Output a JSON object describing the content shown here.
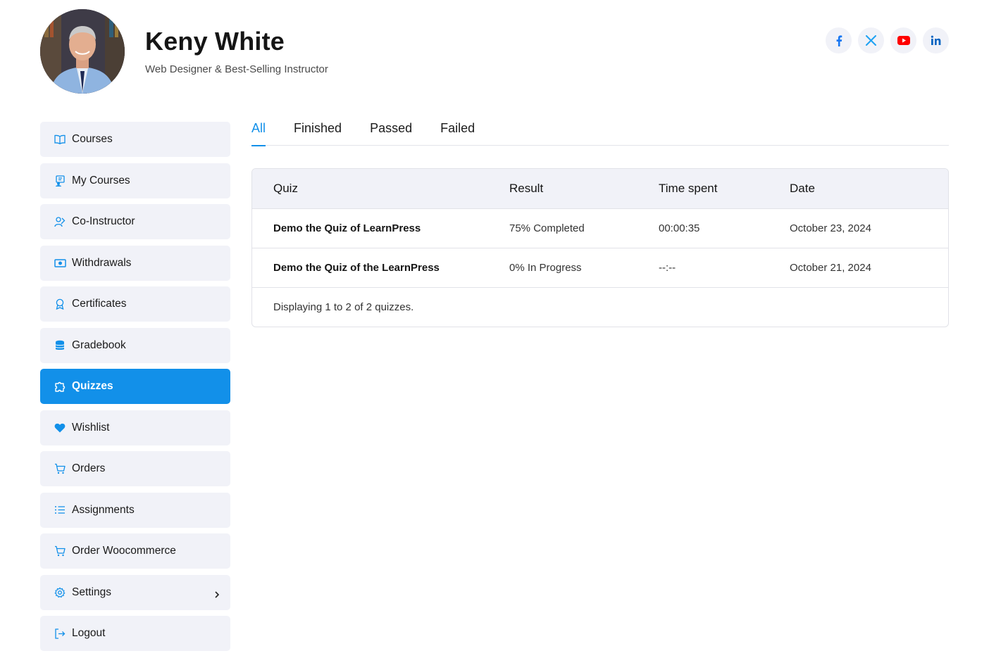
{
  "profile": {
    "name": "Keny White",
    "role": "Web Designer & Best-Selling Instructor"
  },
  "socials": [
    {
      "icon": "facebook-icon",
      "color": "#1877f2"
    },
    {
      "icon": "x-twitter-icon",
      "color": "#1da1f2"
    },
    {
      "icon": "youtube-icon",
      "color": "#ff0000"
    },
    {
      "icon": "linkedin-icon",
      "color": "#0a66c2"
    }
  ],
  "sidebar": {
    "items": [
      {
        "label": "Courses",
        "icon": "book-open-icon"
      },
      {
        "label": "My Courses",
        "icon": "my-courses-icon"
      },
      {
        "label": "Co-Instructor",
        "icon": "users-icon"
      },
      {
        "label": "Withdrawals",
        "icon": "money-icon"
      },
      {
        "label": "Certificates",
        "icon": "award-icon"
      },
      {
        "label": "Gradebook",
        "icon": "database-icon"
      },
      {
        "label": "Quizzes",
        "icon": "puzzle-icon",
        "active": true
      },
      {
        "label": "Wishlist",
        "icon": "heart-icon"
      },
      {
        "label": "Orders",
        "icon": "cart-icon"
      },
      {
        "label": "Assignments",
        "icon": "list-icon"
      },
      {
        "label": "Order Woocommerce",
        "icon": "cart-icon"
      },
      {
        "label": "Settings",
        "icon": "gear-icon"
      },
      {
        "label": "Logout",
        "icon": "logout-icon"
      }
    ]
  },
  "tabs": [
    {
      "label": "All",
      "active": true
    },
    {
      "label": "Finished"
    },
    {
      "label": "Passed"
    },
    {
      "label": "Failed"
    }
  ],
  "table": {
    "headers": [
      "Quiz",
      "Result",
      "Time spent",
      "Date"
    ],
    "rows": [
      [
        "Demo the Quiz of LearnPress",
        "75% Completed",
        "00:00:35",
        "October 23, 2024"
      ],
      [
        "Demo the Quiz of the LearnPress",
        "0% In Progress",
        "--:--",
        "October 21, 2024"
      ]
    ],
    "footer": "Displaying 1 to 2 of 2 quizzes."
  },
  "colors": {
    "accent": "#1290e9",
    "nav_bg": "#f1f2f8"
  }
}
